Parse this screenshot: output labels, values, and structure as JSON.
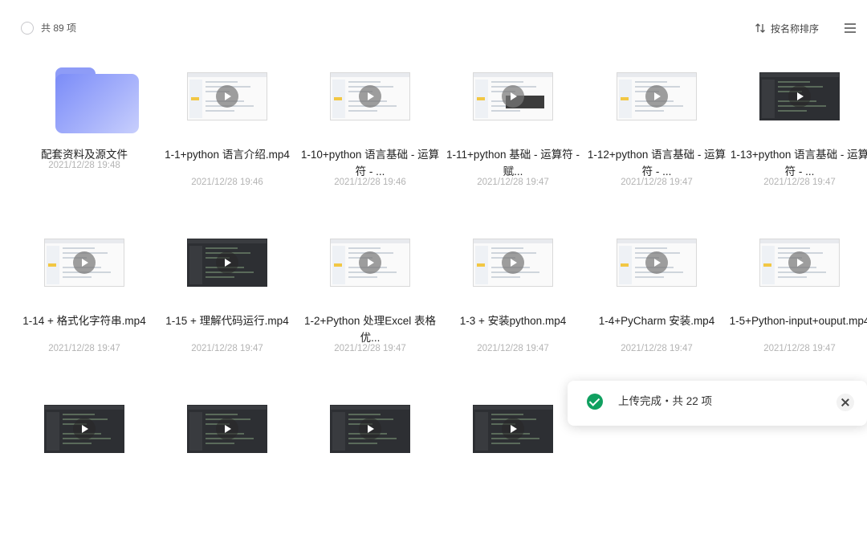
{
  "header": {
    "count_label": "共 89 项",
    "sort_label": "按名称排序"
  },
  "files": [
    {
      "name": "配套资料及源文件",
      "date": "2021/12/28 19:48",
      "type": "folder"
    },
    {
      "name": "1-1+python 语言介绍.mp4",
      "date": "2021/12/28 19:46",
      "type": "video",
      "thumb": "light"
    },
    {
      "name": "1-10+python 语言基础 - 运算符 - ...",
      "date": "2021/12/28 19:46",
      "type": "video",
      "thumb": "light"
    },
    {
      "name": "1-11+python 基础 - 运算符 - 赋...",
      "date": "2021/12/28 19:47",
      "type": "video",
      "thumb": "light"
    },
    {
      "name": "1-12+python 语言基础 - 运算符 - ...",
      "date": "2021/12/28 19:47",
      "type": "video",
      "thumb": "light"
    },
    {
      "name": "1-13+python 语言基础 - 运算符 - ...",
      "date": "2021/12/28 19:47",
      "type": "video",
      "thumb": "dark"
    },
    {
      "name": "1-14 + 格式化字符串.mp4",
      "date": "2021/12/28 19:47",
      "type": "video",
      "thumb": "light"
    },
    {
      "name": "1-15 + 理解代码运行.mp4",
      "date": "2021/12/28 19:47",
      "type": "video",
      "thumb": "dark"
    },
    {
      "name": "1-2+Python 处理Excel 表格优...",
      "date": "2021/12/28 19:47",
      "type": "video",
      "thumb": "light"
    },
    {
      "name": "1-3 + 安装python.mp4",
      "date": "2021/12/28 19:47",
      "type": "video",
      "thumb": "light"
    },
    {
      "name": "1-4+PyCharm 安装.mp4",
      "date": "2021/12/28 19:47",
      "type": "video",
      "thumb": "light"
    },
    {
      "name": "1-5+Python-input+ouput.mp4",
      "date": "2021/12/28 19:47",
      "type": "video",
      "thumb": "light"
    },
    {
      "name": "",
      "date": "",
      "type": "video",
      "thumb": "dark"
    },
    {
      "name": "",
      "date": "",
      "type": "video",
      "thumb": "dark"
    },
    {
      "name": "",
      "date": "",
      "type": "video",
      "thumb": "dark"
    },
    {
      "name": "",
      "date": "",
      "type": "video",
      "thumb": "dark"
    }
  ],
  "toast": {
    "message": "上传完成・共 22 项"
  },
  "colors": {
    "folder": "#8e9cf7",
    "success": "#10a060",
    "date_text": "#b4b4b4"
  }
}
